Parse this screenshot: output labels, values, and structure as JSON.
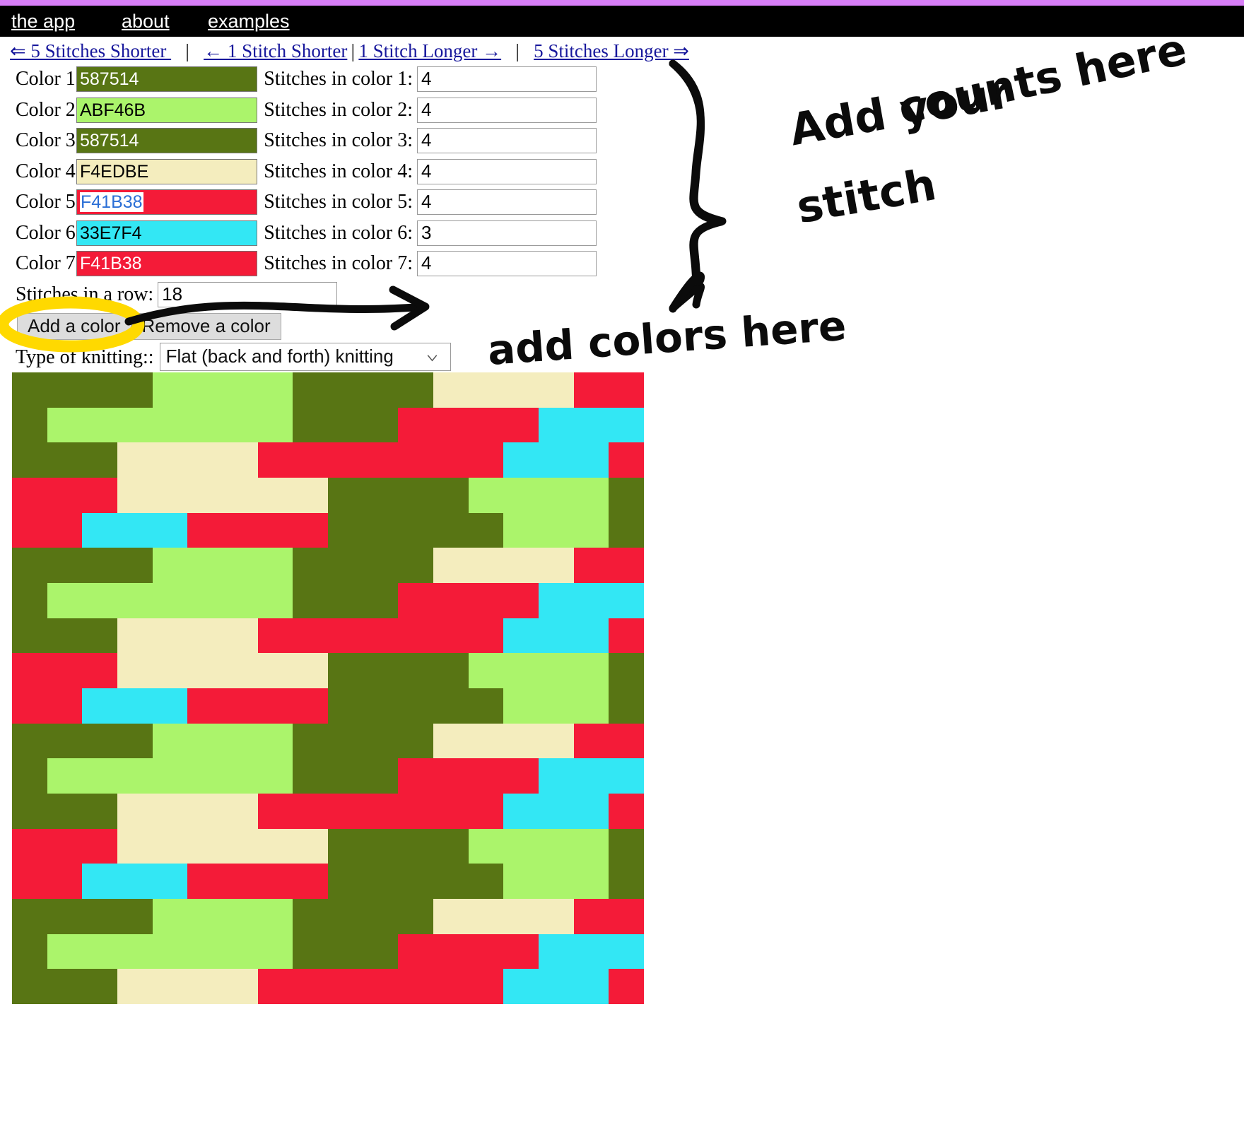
{
  "theme": {
    "accent_bar": "#D87EF7",
    "nav_background": "#000000",
    "link_color": "#18189C",
    "highlight_marker": "#FFD900",
    "annotation_ink": "#0B0B0B"
  },
  "nav": {
    "items": [
      {
        "label": "the app",
        "name": "nav-the-app"
      },
      {
        "label": "about",
        "name": "nav-about"
      },
      {
        "label": "examples",
        "name": "nav-examples"
      }
    ]
  },
  "length_controls": {
    "shorter_5": "⇐ 5 Stitches Shorter ",
    "shorter_1": "← 1 Stitch Shorter",
    "longer_1": "1 Stitch Longer →",
    "longer_5": "5 Stitches Longer ⇒",
    "separator": "|"
  },
  "colors": [
    {
      "label": "Color 1:",
      "value": "587514",
      "swatch": "#587514",
      "text_color": "#FFFFFF",
      "selected": false,
      "count_label": "Stitches in color 1:",
      "count": "4"
    },
    {
      "label": "Color 2:",
      "value": "ABF46B",
      "swatch": "#ABF46B",
      "text_color": "#000000",
      "selected": false,
      "count_label": "Stitches in color 2:",
      "count": "4"
    },
    {
      "label": "Color 3:",
      "value": "587514",
      "swatch": "#587514",
      "text_color": "#FFFFFF",
      "selected": false,
      "count_label": "Stitches in color 3:",
      "count": "4"
    },
    {
      "label": "Color 4:",
      "value": "F4EDBE",
      "swatch": "#F4EDBE",
      "text_color": "#000000",
      "selected": false,
      "count_label": "Stitches in color 4:",
      "count": "4"
    },
    {
      "label": "Color 5:",
      "value": "F41B38",
      "swatch": "#F41B38",
      "text_color": "#2B6FD6",
      "selected": true,
      "count_label": "Stitches in color 5:",
      "count": "4"
    },
    {
      "label": "Color 6:",
      "value": "33E7F4",
      "swatch": "#33E7F4",
      "text_color": "#000000",
      "selected": false,
      "count_label": "Stitches in color 6:",
      "count": "3"
    },
    {
      "label": "Color 7:",
      "value": "F41B38",
      "swatch": "#F41B38",
      "text_color": "#FFFFFF",
      "selected": false,
      "count_label": "Stitches in color 7:",
      "count": "4"
    }
  ],
  "row_count": {
    "label": "Stitches in a row:",
    "value": "18"
  },
  "buttons": {
    "add_color": "Add a color",
    "remove_color": "Remove a color"
  },
  "knitting_type": {
    "label": "Type of knitting::",
    "selected": "Flat (back and forth) knitting",
    "chevron_icon": "chevron-down-icon"
  },
  "annotations": [
    {
      "name": "annotation-add-your",
      "text": "Add your"
    },
    {
      "name": "annotation-counts-here",
      "text": "counts here"
    },
    {
      "name": "annotation-stitch",
      "text": "stitch"
    },
    {
      "name": "annotation-add-colors-here",
      "text": "add colors here"
    }
  ],
  "chart_data": {
    "type": "heatmap",
    "title": "",
    "stitches_per_row": 18,
    "rows": 18,
    "knitting_direction": "boustrophedon",
    "color_repeat_sequence": [
      {
        "hex": "#587514",
        "stitches": 4
      },
      {
        "hex": "#ABF46B",
        "stitches": 4
      },
      {
        "hex": "#587514",
        "stitches": 4
      },
      {
        "hex": "#F4EDBE",
        "stitches": 4
      },
      {
        "hex": "#F41B38",
        "stitches": 4
      },
      {
        "hex": "#33E7F4",
        "stitches": 3
      },
      {
        "hex": "#F41B38",
        "stitches": 4
      }
    ],
    "repeat_length": 27,
    "palette": [
      "#587514",
      "#ABF46B",
      "#F4EDBE",
      "#F41B38",
      "#33E7F4"
    ],
    "grid": [
      [
        "#587514",
        "#587514",
        "#587514",
        "#587514",
        "#ABF46B",
        "#ABF46B",
        "#ABF46B",
        "#ABF46B",
        "#587514",
        "#587514",
        "#587514",
        "#587514",
        "#F4EDBE",
        "#F4EDBE",
        "#F4EDBE",
        "#F4EDBE",
        "#F41B38",
        "#F41B38"
      ],
      [
        "#587514",
        "#ABF46B",
        "#ABF46B",
        "#ABF46B",
        "#ABF46B",
        "#ABF46B",
        "#ABF46B",
        "#ABF46B",
        "#587514",
        "#587514",
        "#587514",
        "#F41B38",
        "#F41B38",
        "#F41B38",
        "#F41B38",
        "#33E7F4",
        "#33E7F4",
        "#33E7F4"
      ],
      [
        "#587514",
        "#587514",
        "#587514",
        "#F4EDBE",
        "#F4EDBE",
        "#F4EDBE",
        "#F4EDBE",
        "#F41B38",
        "#F41B38",
        "#F41B38",
        "#F41B38",
        "#F41B38",
        "#F41B38",
        "#F41B38",
        "#33E7F4",
        "#33E7F4",
        "#33E7F4",
        "#F41B38"
      ],
      [
        "#F41B38",
        "#F41B38",
        "#F41B38",
        "#F4EDBE",
        "#F4EDBE",
        "#F4EDBE",
        "#F4EDBE",
        "#F4EDBE",
        "#F4EDBE",
        "#587514",
        "#587514",
        "#587514",
        "#587514",
        "#ABF46B",
        "#ABF46B",
        "#ABF46B",
        "#ABF46B",
        "#587514"
      ],
      [
        "#F41B38",
        "#F41B38",
        "#33E7F4",
        "#33E7F4",
        "#33E7F4",
        "#F41B38",
        "#F41B38",
        "#F41B38",
        "#F41B38",
        "#587514",
        "#587514",
        "#587514",
        "#587514",
        "#587514",
        "#ABF46B",
        "#ABF46B",
        "#ABF46B",
        "#587514"
      ],
      [
        "#587514",
        "#587514",
        "#587514",
        "#587514",
        "#ABF46B",
        "#ABF46B",
        "#ABF46B",
        "#ABF46B",
        "#587514",
        "#587514",
        "#587514",
        "#587514",
        "#F4EDBE",
        "#F4EDBE",
        "#F4EDBE",
        "#F4EDBE",
        "#F41B38",
        "#F41B38"
      ],
      [
        "#587514",
        "#ABF46B",
        "#ABF46B",
        "#ABF46B",
        "#ABF46B",
        "#ABF46B",
        "#ABF46B",
        "#ABF46B",
        "#587514",
        "#587514",
        "#587514",
        "#F41B38",
        "#F41B38",
        "#F41B38",
        "#F41B38",
        "#33E7F4",
        "#33E7F4",
        "#33E7F4"
      ],
      [
        "#587514",
        "#587514",
        "#587514",
        "#F4EDBE",
        "#F4EDBE",
        "#F4EDBE",
        "#F4EDBE",
        "#F41B38",
        "#F41B38",
        "#F41B38",
        "#F41B38",
        "#F41B38",
        "#F41B38",
        "#F41B38",
        "#33E7F4",
        "#33E7F4",
        "#33E7F4",
        "#F41B38"
      ],
      [
        "#F41B38",
        "#F41B38",
        "#F41B38",
        "#F4EDBE",
        "#F4EDBE",
        "#F4EDBE",
        "#F4EDBE",
        "#F4EDBE",
        "#F4EDBE",
        "#587514",
        "#587514",
        "#587514",
        "#587514",
        "#ABF46B",
        "#ABF46B",
        "#ABF46B",
        "#ABF46B",
        "#587514"
      ],
      [
        "#F41B38",
        "#F41B38",
        "#33E7F4",
        "#33E7F4",
        "#33E7F4",
        "#F41B38",
        "#F41B38",
        "#F41B38",
        "#F41B38",
        "#587514",
        "#587514",
        "#587514",
        "#587514",
        "#587514",
        "#ABF46B",
        "#ABF46B",
        "#ABF46B",
        "#587514"
      ],
      [
        "#587514",
        "#587514",
        "#587514",
        "#587514",
        "#ABF46B",
        "#ABF46B",
        "#ABF46B",
        "#ABF46B",
        "#587514",
        "#587514",
        "#587514",
        "#587514",
        "#F4EDBE",
        "#F4EDBE",
        "#F4EDBE",
        "#F4EDBE",
        "#F41B38",
        "#F41B38"
      ],
      [
        "#587514",
        "#ABF46B",
        "#ABF46B",
        "#ABF46B",
        "#ABF46B",
        "#ABF46B",
        "#ABF46B",
        "#ABF46B",
        "#587514",
        "#587514",
        "#587514",
        "#F41B38",
        "#F41B38",
        "#F41B38",
        "#F41B38",
        "#33E7F4",
        "#33E7F4",
        "#33E7F4"
      ],
      [
        "#587514",
        "#587514",
        "#587514",
        "#F4EDBE",
        "#F4EDBE",
        "#F4EDBE",
        "#F4EDBE",
        "#F41B38",
        "#F41B38",
        "#F41B38",
        "#F41B38",
        "#F41B38",
        "#F41B38",
        "#F41B38",
        "#33E7F4",
        "#33E7F4",
        "#33E7F4",
        "#F41B38"
      ],
      [
        "#F41B38",
        "#F41B38",
        "#F41B38",
        "#F4EDBE",
        "#F4EDBE",
        "#F4EDBE",
        "#F4EDBE",
        "#F4EDBE",
        "#F4EDBE",
        "#587514",
        "#587514",
        "#587514",
        "#587514",
        "#ABF46B",
        "#ABF46B",
        "#ABF46B",
        "#ABF46B",
        "#587514"
      ],
      [
        "#F41B38",
        "#F41B38",
        "#33E7F4",
        "#33E7F4",
        "#33E7F4",
        "#F41B38",
        "#F41B38",
        "#F41B38",
        "#F41B38",
        "#587514",
        "#587514",
        "#587514",
        "#587514",
        "#587514",
        "#ABF46B",
        "#ABF46B",
        "#ABF46B",
        "#587514"
      ],
      [
        "#587514",
        "#587514",
        "#587514",
        "#587514",
        "#ABF46B",
        "#ABF46B",
        "#ABF46B",
        "#ABF46B",
        "#587514",
        "#587514",
        "#587514",
        "#587514",
        "#F4EDBE",
        "#F4EDBE",
        "#F4EDBE",
        "#F4EDBE",
        "#F41B38",
        "#F41B38"
      ],
      [
        "#587514",
        "#ABF46B",
        "#ABF46B",
        "#ABF46B",
        "#ABF46B",
        "#ABF46B",
        "#ABF46B",
        "#ABF46B",
        "#587514",
        "#587514",
        "#587514",
        "#F41B38",
        "#F41B38",
        "#F41B38",
        "#F41B38",
        "#33E7F4",
        "#33E7F4",
        "#33E7F4"
      ],
      [
        "#587514",
        "#587514",
        "#587514",
        "#F4EDBE",
        "#F4EDBE",
        "#F4EDBE",
        "#F4EDBE",
        "#F41B38",
        "#F41B38",
        "#F41B38",
        "#F41B38",
        "#F41B38",
        "#F41B38",
        "#F41B38",
        "#33E7F4",
        "#33E7F4",
        "#33E7F4",
        "#F41B38"
      ]
    ]
  }
}
